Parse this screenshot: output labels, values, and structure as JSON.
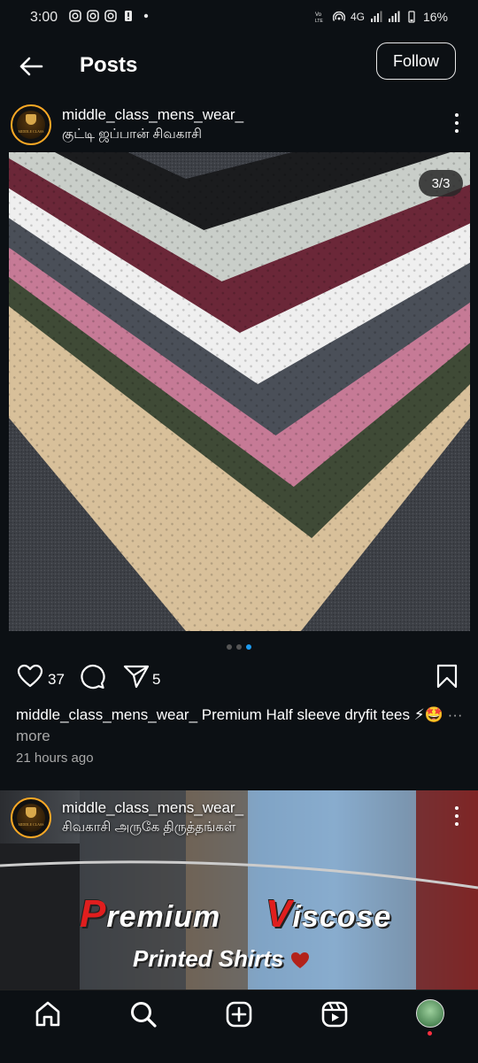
{
  "status_bar": {
    "time": "3:00",
    "network": "4G",
    "battery": "16%"
  },
  "header": {
    "title": "Posts",
    "follow_label": "Follow"
  },
  "post1": {
    "username": "middle_class_mens_wear_",
    "location": "குட்டி ஜப்பான் சிவகாசி",
    "carousel_position": "3/3",
    "carousel_total": 3,
    "carousel_active_index": 3,
    "likes": "37",
    "shares": "5",
    "caption_user": "middle_class_mens_wear_",
    "caption_text": " Premium  Half sleeve dryfit tees ⚡🤩",
    "caption_more": "··· more",
    "time_ago": "21 hours ago",
    "fabric_colors": [
      "#1b1c1e",
      "#c9cec9",
      "#6b2738",
      "#efefef",
      "#4a4f58",
      "#c67a96",
      "#3f4a36",
      "#d8c09a"
    ]
  },
  "post2": {
    "username": "middle_class_mens_wear_",
    "location": "சிவகாசி அருகே திருத்தங்கள்",
    "promo_line1_a_initial": "P",
    "promo_line1_a_rest": "remium",
    "promo_line1_b_initial": "V",
    "promo_line1_b_rest": "iscose",
    "promo_line2": "Printed Shirts"
  },
  "avatar_logo_text": "MIDDLE CLASS",
  "colors": {
    "background": "#0c1014",
    "accent": "#1d9bf0",
    "notification": "#ff3040"
  },
  "icons": {
    "back": "arrow-left-icon",
    "like": "heart-icon",
    "comment": "comment-icon",
    "share": "send-icon",
    "save": "bookmark-icon",
    "home": "home-icon",
    "search": "search-icon",
    "create": "plus-square-icon",
    "reels": "reels-icon"
  }
}
